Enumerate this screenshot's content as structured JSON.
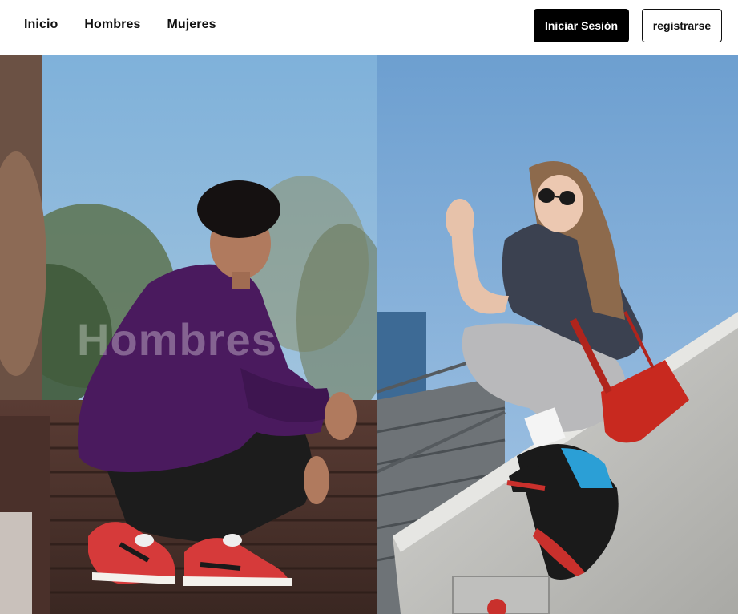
{
  "nav": {
    "links": [
      {
        "label": "Inicio"
      },
      {
        "label": "Hombres"
      },
      {
        "label": "Mujeres"
      }
    ],
    "login_label": "Iniciar Sesión",
    "register_label": "registrarse"
  },
  "hero": {
    "men": {
      "title": "Hombres",
      "image": "photo-young-man-purple-hoodie-red-sneakers"
    },
    "women": {
      "image": "photo-young-woman-sunglasses-red-bag-sneakers"
    }
  },
  "colors": {
    "login_bg": "#000000",
    "register_border": "#111111",
    "hoodie": "#4a1a5e",
    "sky": "#8bb4d8"
  }
}
